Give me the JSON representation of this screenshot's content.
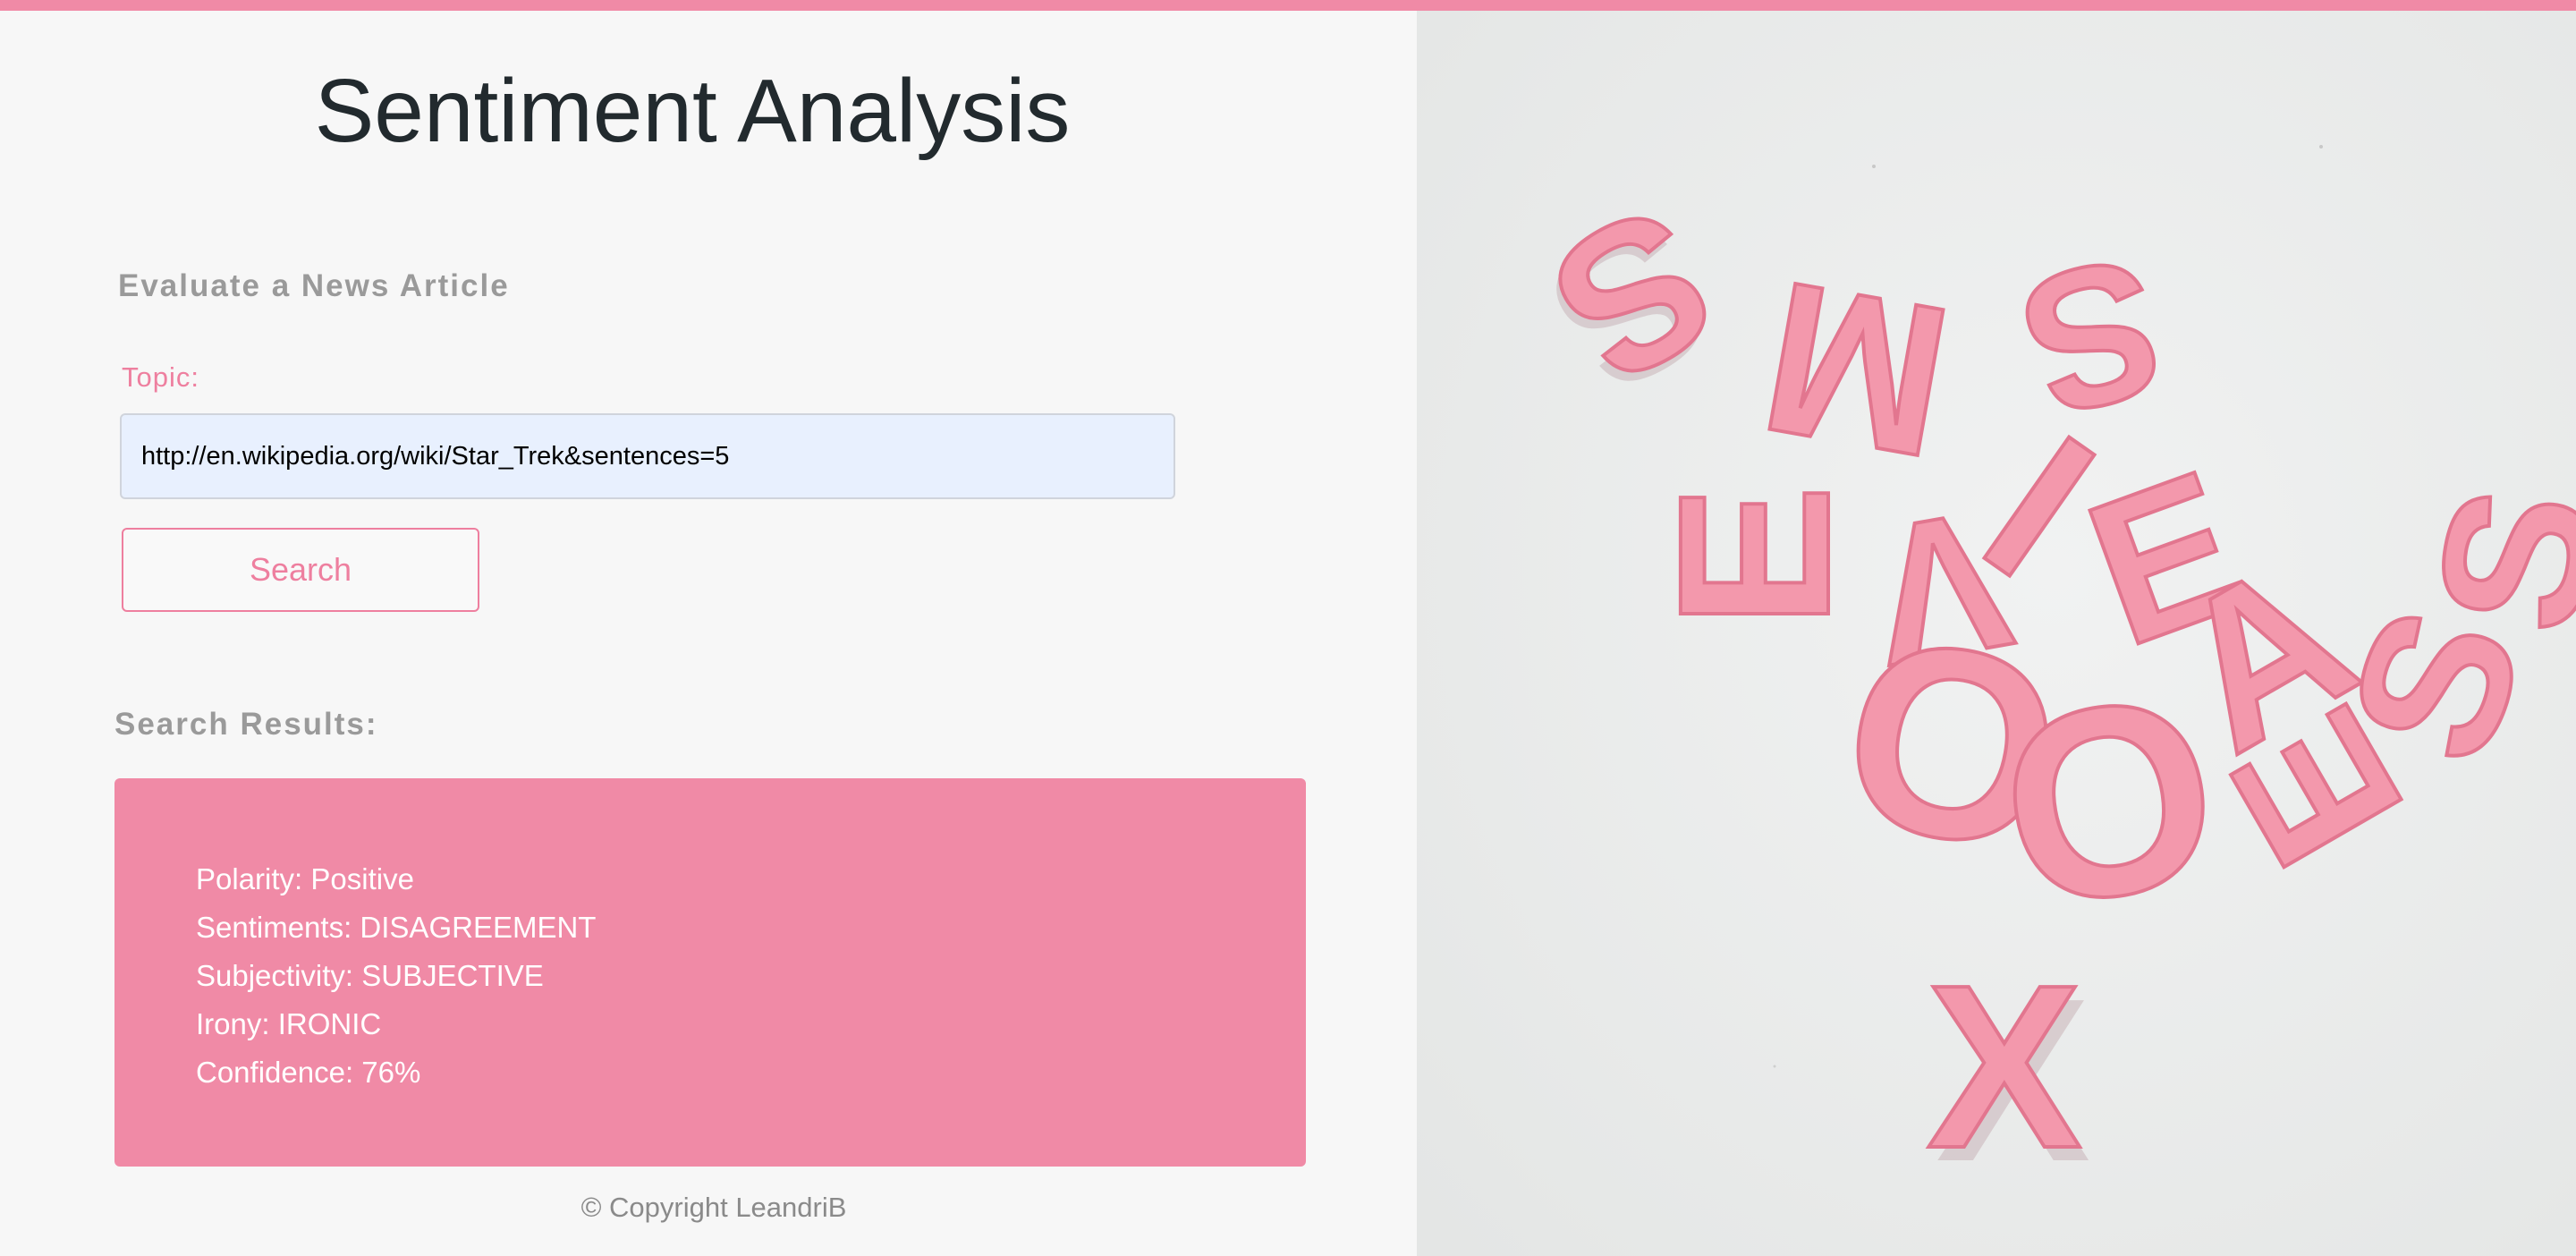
{
  "page": {
    "title": "Sentiment Analysis",
    "accent_color": "#f08aa6"
  },
  "form": {
    "heading": "Evaluate a News Article",
    "topic_label": "Topic:",
    "topic_value": "http://en.wikipedia.org/wiki/Star_Trek&sentences=5",
    "search_label": "Search"
  },
  "results": {
    "heading": "Search Results:",
    "items": [
      "Polarity: Positive",
      "Sentiments: DISAGREEMENT",
      "Subjectivity: SUBJECTIVE",
      "Irony: IRONIC",
      "Confidence: 76%"
    ]
  },
  "footer": {
    "copyright": "© Copyright LeandriB"
  },
  "hero_image": {
    "letters": [
      "S",
      "M",
      "S",
      "I",
      "E",
      "V",
      "E",
      "O",
      "O",
      "A",
      "E",
      "S",
      "S",
      "X"
    ]
  }
}
